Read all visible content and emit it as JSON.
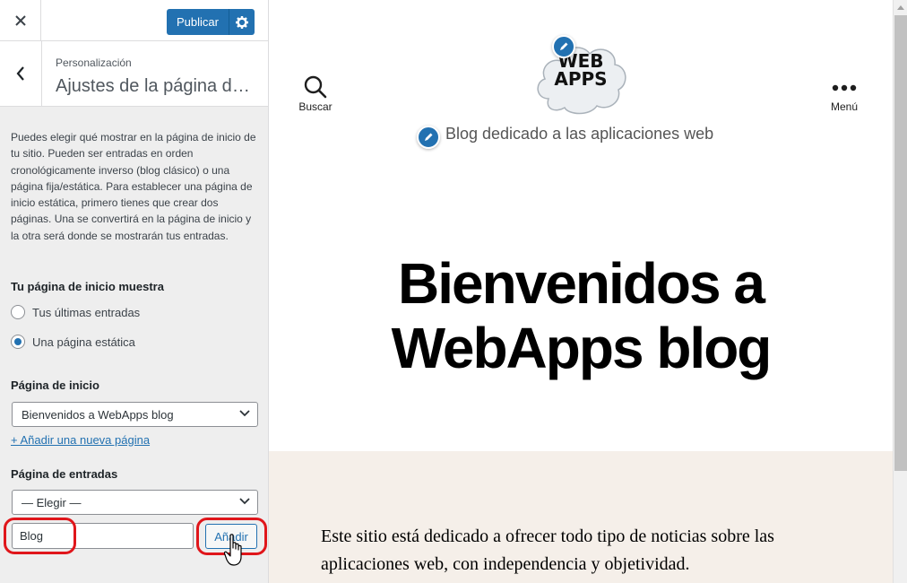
{
  "topbar": {
    "publish_label": "Publicar"
  },
  "section": {
    "breadcrumb": "Personalización",
    "title": "Ajustes de la página de inicio"
  },
  "description": "Puedes elegir qué mostrar en la página de inicio de tu sitio. Pueden ser entradas en orden cronológicamente inverso (blog clásico) o una página fija/estática. Para establecer una página de inicio estática, primero tienes que crear dos páginas. Una se convertirá en la página de inicio y la otra será donde se mostrarán tus entradas.",
  "homepage_display": {
    "label": "Tu página de inicio muestra",
    "options": [
      {
        "label": "Tus últimas entradas",
        "selected": false
      },
      {
        "label": "Una página estática",
        "selected": true
      }
    ]
  },
  "front_page": {
    "label": "Página de inicio",
    "selected": "Bienvenidos a WebApps blog",
    "add_link": "+ Añadir una nueva página"
  },
  "posts_page": {
    "label": "Página de entradas",
    "selected": "— Elegir —",
    "new_page_value": "Blog",
    "add_button": "Añadir"
  },
  "preview": {
    "search_label": "Buscar",
    "menu_label": "Menú",
    "logo_line1": "WEB",
    "logo_line2": "APPS",
    "tagline": "Blog dedicado a las aplicaciones web",
    "hero_title": "Bienvenidos a WebApps blog",
    "intro": "Este sitio está dedicado a ofrecer todo tipo de noticias sobre las aplicaciones web, con independencia y objetividad."
  },
  "colors": {
    "accent": "#2271b1",
    "highlight": "#e0161b",
    "cream": "#f5efe9"
  }
}
